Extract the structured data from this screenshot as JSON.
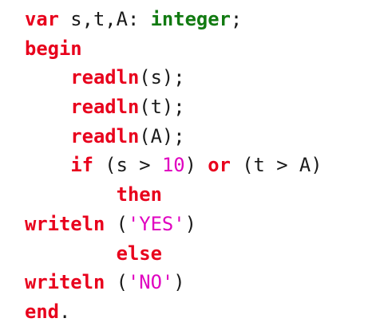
{
  "code": {
    "lines": [
      [
        {
          "t": "var",
          "c": "kw"
        },
        {
          "t": " s,t,A: ",
          "c": "plain"
        },
        {
          "t": "integer",
          "c": "type"
        },
        {
          "t": ";",
          "c": "plain"
        }
      ],
      [
        {
          "t": "begin",
          "c": "kw"
        }
      ],
      [
        {
          "t": "    ",
          "c": "plain"
        },
        {
          "t": "readln",
          "c": "kw"
        },
        {
          "t": "(s);",
          "c": "plain"
        }
      ],
      [
        {
          "t": "    ",
          "c": "plain"
        },
        {
          "t": "readln",
          "c": "kw"
        },
        {
          "t": "(t);",
          "c": "plain"
        }
      ],
      [
        {
          "t": "    ",
          "c": "plain"
        },
        {
          "t": "readln",
          "c": "kw"
        },
        {
          "t": "(A);",
          "c": "plain"
        }
      ],
      [
        {
          "t": "    ",
          "c": "plain"
        },
        {
          "t": "if",
          "c": "kw"
        },
        {
          "t": " (s > ",
          "c": "plain"
        },
        {
          "t": "10",
          "c": "num"
        },
        {
          "t": ") ",
          "c": "plain"
        },
        {
          "t": "or",
          "c": "kw"
        },
        {
          "t": " (t > A)",
          "c": "plain"
        }
      ],
      [
        {
          "t": "        ",
          "c": "plain"
        },
        {
          "t": "then",
          "c": "kw"
        }
      ],
      [
        {
          "t": "writeln",
          "c": "kw"
        },
        {
          "t": " (",
          "c": "plain"
        },
        {
          "t": "'YES'",
          "c": "str"
        },
        {
          "t": ")",
          "c": "plain"
        }
      ],
      [
        {
          "t": "        ",
          "c": "plain"
        },
        {
          "t": "else",
          "c": "kw"
        }
      ],
      [
        {
          "t": "writeln",
          "c": "kw"
        },
        {
          "t": " (",
          "c": "plain"
        },
        {
          "t": "'NO'",
          "c": "str"
        },
        {
          "t": ")",
          "c": "plain"
        }
      ],
      [
        {
          "t": "end",
          "c": "kw"
        },
        {
          "t": ".",
          "c": "plain"
        }
      ]
    ]
  },
  "colors": {
    "keyword": "#e8001c",
    "type": "#117a11",
    "string": "#e000c0",
    "number": "#e000c0",
    "text": "#1a1a1a",
    "background": "#ffffff"
  }
}
